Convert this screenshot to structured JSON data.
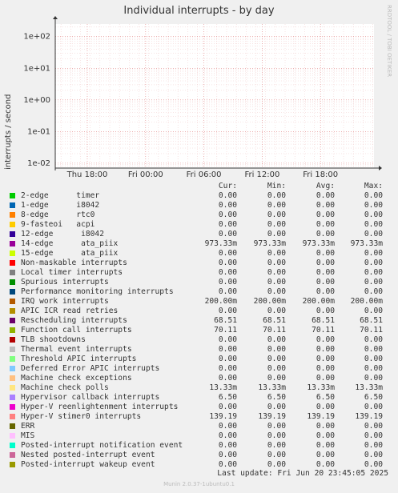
{
  "chart_data": {
    "type": "line",
    "title": "Individual interrupts - by day",
    "ylabel": "interrupts / second",
    "y_scale": "log",
    "ylim": [
      0.007,
      250
    ],
    "y_ticks": [
      {
        "value": 100,
        "label": "1e+02"
      },
      {
        "value": 10,
        "label": "1e+01"
      },
      {
        "value": 1,
        "label": "1e+00"
      },
      {
        "value": 0.1,
        "label": "1e-01"
      },
      {
        "value": 0.01,
        "label": "1e-02"
      }
    ],
    "x_ticks": [
      "Thu 18:00",
      "Fri 00:00",
      "Fri 06:00",
      "Fri 12:00",
      "Fri 18:00"
    ],
    "grid": true,
    "legend_headers": [
      "Cur:",
      "Min:",
      "Avg:",
      "Max:"
    ],
    "series": [
      {
        "name": "2-edge      timer",
        "color": "#00cc00",
        "cur": "0.00",
        "min": "0.00",
        "avg": "0.00",
        "max": "0.00"
      },
      {
        "name": "1-edge      i8042",
        "color": "#0066b3",
        "cur": "0.00",
        "min": "0.00",
        "avg": "0.00",
        "max": "0.00"
      },
      {
        "name": "8-edge      rtc0",
        "color": "#ff8000",
        "cur": "0.00",
        "min": "0.00",
        "avg": "0.00",
        "max": "0.00"
      },
      {
        "name": "9-fasteoi   acpi",
        "color": "#ffcc00",
        "cur": "0.00",
        "min": "0.00",
        "avg": "0.00",
        "max": "0.00"
      },
      {
        "name": "12-edge      i8042",
        "color": "#330099",
        "cur": "0.00",
        "min": "0.00",
        "avg": "0.00",
        "max": "0.00"
      },
      {
        "name": "14-edge      ata_piix",
        "color": "#990099",
        "cur": "973.33m",
        "min": "973.33m",
        "avg": "973.33m",
        "max": "973.33m"
      },
      {
        "name": "15-edge      ata_piix",
        "color": "#ccff00",
        "cur": "0.00",
        "min": "0.00",
        "avg": "0.00",
        "max": "0.00"
      },
      {
        "name": "Non-maskable interrupts",
        "color": "#ff0000",
        "cur": "0.00",
        "min": "0.00",
        "avg": "0.00",
        "max": "0.00"
      },
      {
        "name": "Local timer interrupts",
        "color": "#808080",
        "cur": "0.00",
        "min": "0.00",
        "avg": "0.00",
        "max": "0.00"
      },
      {
        "name": "Spurious interrupts",
        "color": "#008f00",
        "cur": "0.00",
        "min": "0.00",
        "avg": "0.00",
        "max": "0.00"
      },
      {
        "name": "Performance monitoring interrupts",
        "color": "#00487d",
        "cur": "0.00",
        "min": "0.00",
        "avg": "0.00",
        "max": "0.00"
      },
      {
        "name": "IRQ work interrupts",
        "color": "#b35a00",
        "cur": "200.00m",
        "min": "200.00m",
        "avg": "200.00m",
        "max": "200.00m"
      },
      {
        "name": "APIC ICR read retries",
        "color": "#b38f00",
        "cur": "0.00",
        "min": "0.00",
        "avg": "0.00",
        "max": "0.00"
      },
      {
        "name": "Rescheduling interrupts",
        "color": "#6b006b",
        "cur": "68.51",
        "min": "68.51",
        "avg": "68.51",
        "max": "68.51"
      },
      {
        "name": "Function call interrupts",
        "color": "#8fb300",
        "cur": "70.11",
        "min": "70.11",
        "avg": "70.11",
        "max": "70.11"
      },
      {
        "name": "TLB shootdowns",
        "color": "#b30000",
        "cur": "0.00",
        "min": "0.00",
        "avg": "0.00",
        "max": "0.00"
      },
      {
        "name": "Thermal event interrupts",
        "color": "#bebebe",
        "cur": "0.00",
        "min": "0.00",
        "avg": "0.00",
        "max": "0.00"
      },
      {
        "name": "Threshold APIC interrupts",
        "color": "#80ff80",
        "cur": "0.00",
        "min": "0.00",
        "avg": "0.00",
        "max": "0.00"
      },
      {
        "name": "Deferred Error APIC interrupts",
        "color": "#80c9ff",
        "cur": "0.00",
        "min": "0.00",
        "avg": "0.00",
        "max": "0.00"
      },
      {
        "name": "Machine check exceptions",
        "color": "#ffc080",
        "cur": "0.00",
        "min": "0.00",
        "avg": "0.00",
        "max": "0.00"
      },
      {
        "name": "Machine check polls",
        "color": "#ffe680",
        "cur": "13.33m",
        "min": "13.33m",
        "avg": "13.33m",
        "max": "13.33m"
      },
      {
        "name": "Hypervisor callback interrupts",
        "color": "#aa80ff",
        "cur": "6.50",
        "min": "6.50",
        "avg": "6.50",
        "max": "6.50"
      },
      {
        "name": "Hyper-V reenlightenment interrupts",
        "color": "#ee00cc",
        "cur": "0.00",
        "min": "0.00",
        "avg": "0.00",
        "max": "0.00"
      },
      {
        "name": "Hyper-V stimer0 interrupts",
        "color": "#ff8080",
        "cur": "139.19",
        "min": "139.19",
        "avg": "139.19",
        "max": "139.19"
      },
      {
        "name": "ERR",
        "color": "#666600",
        "cur": "0.00",
        "min": "0.00",
        "avg": "0.00",
        "max": "0.00"
      },
      {
        "name": "MIS",
        "color": "#ffbfff",
        "cur": "0.00",
        "min": "0.00",
        "avg": "0.00",
        "max": "0.00"
      },
      {
        "name": "Posted-interrupt notification event",
        "color": "#00ffcc",
        "cur": "0.00",
        "min": "0.00",
        "avg": "0.00",
        "max": "0.00"
      },
      {
        "name": "Nested posted-interrupt event",
        "color": "#cc6699",
        "cur": "0.00",
        "min": "0.00",
        "avg": "0.00",
        "max": "0.00"
      },
      {
        "name": "Posted-interrupt wakeup event",
        "color": "#999900",
        "cur": "0.00",
        "min": "0.00",
        "avg": "0.00",
        "max": "0.00"
      }
    ]
  },
  "watermark": "RRDTOOL / TOBI OETIKER",
  "last_update": "Last update: Fri Jun 20 23:45:05 2025",
  "footer": "Munin 2.0.37-1ubuntu0.1"
}
